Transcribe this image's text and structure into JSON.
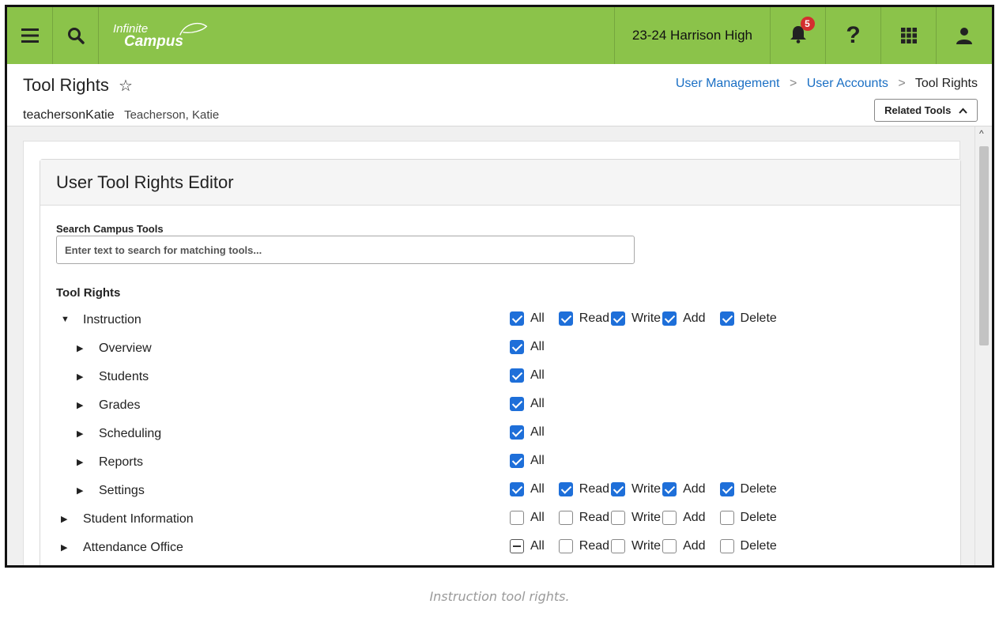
{
  "header": {
    "logo_line1": "Infinite",
    "logo_line2": "Campus",
    "school": "23-24 Harrison High",
    "notification_count": "5",
    "help_glyph": "?",
    "bar_color": "#8bc34a"
  },
  "page": {
    "title": "Tool Rights",
    "username": "teachersonKatie",
    "fullname": "Teacherson, Katie",
    "breadcrumb": [
      "User Management",
      "User Accounts",
      "Tool Rights"
    ],
    "breadcrumb_sep": ">",
    "related_tools": "Related Tools"
  },
  "editor": {
    "title": "User Tool Rights Editor",
    "search_label": "Search Campus Tools",
    "search_placeholder": "Enter text to search for matching tools...",
    "rights_label": "Tool Rights"
  },
  "perm_labels": {
    "all": "All",
    "read": "Read",
    "write": "Write",
    "add": "Add",
    "delete": "Delete"
  },
  "rows": [
    {
      "name": "Instruction",
      "level": 0,
      "expanded": true,
      "all": "checked",
      "read": "checked",
      "write": "checked",
      "add": "checked",
      "delete": "checked",
      "full": true
    },
    {
      "name": "Overview",
      "level": 1,
      "expanded": false,
      "all": "checked",
      "full": false
    },
    {
      "name": "Students",
      "level": 1,
      "expanded": false,
      "all": "checked",
      "full": false
    },
    {
      "name": "Grades",
      "level": 1,
      "expanded": false,
      "all": "checked",
      "full": false
    },
    {
      "name": "Scheduling",
      "level": 1,
      "expanded": false,
      "all": "checked",
      "full": false
    },
    {
      "name": "Reports",
      "level": 1,
      "expanded": false,
      "all": "checked",
      "full": false
    },
    {
      "name": "Settings",
      "level": 1,
      "expanded": false,
      "all": "checked",
      "read": "checked",
      "write": "checked",
      "add": "checked",
      "delete": "checked",
      "full": true
    },
    {
      "name": "Student Information",
      "level": 0,
      "expanded": false,
      "all": "unchecked",
      "read": "unchecked",
      "write": "unchecked",
      "add": "unchecked",
      "delete": "unchecked",
      "full": true
    },
    {
      "name": "Attendance Office",
      "level": 0,
      "expanded": false,
      "all": "partial",
      "read": "unchecked",
      "write": "unchecked",
      "add": "unchecked",
      "delete": "unchecked",
      "full": true
    }
  ],
  "caption": "Instruction tool rights.",
  "colors": {
    "checkbox": "#1e6fd9",
    "link": "#1a6fc4"
  }
}
